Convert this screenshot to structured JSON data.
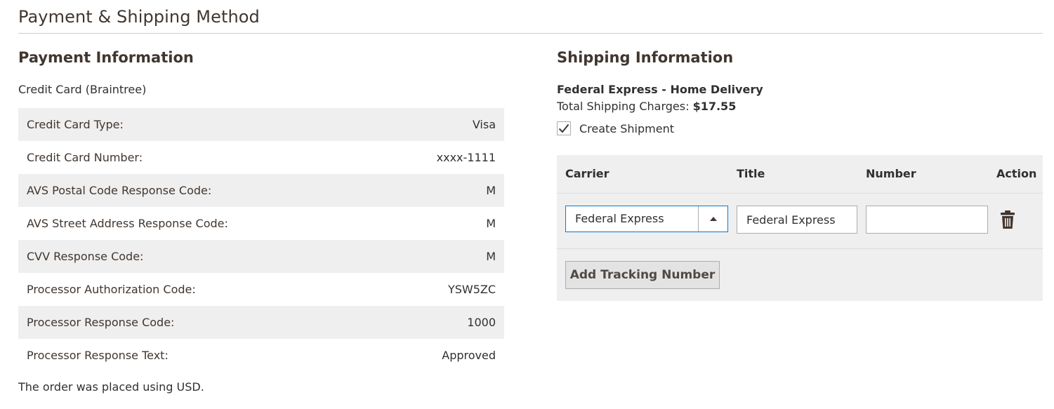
{
  "section": {
    "title": "Payment & Shipping Method"
  },
  "payment": {
    "heading": "Payment Information",
    "method": "Credit Card (Braintree)",
    "rows": [
      {
        "label": "Credit Card Type:",
        "value": "Visa"
      },
      {
        "label": "Credit Card Number:",
        "value": "xxxx-1111"
      },
      {
        "label": "AVS Postal Code Response Code:",
        "value": "M"
      },
      {
        "label": "AVS Street Address Response Code:",
        "value": "M"
      },
      {
        "label": "CVV Response Code:",
        "value": "M"
      },
      {
        "label": "Processor Authorization Code:",
        "value": "YSW5ZC"
      },
      {
        "label": "Processor Response Code:",
        "value": "1000"
      },
      {
        "label": "Processor Response Text:",
        "value": "Approved"
      }
    ],
    "order_note": "The order was placed using USD."
  },
  "shipping": {
    "heading": "Shipping Information",
    "method": "Federal Express - Home Delivery",
    "charges_label": "Total Shipping Charges:",
    "charges_value": "$17.55",
    "create_shipment_label": "Create Shipment",
    "create_shipment_checked": true,
    "tracking": {
      "headers": {
        "carrier": "Carrier",
        "title": "Title",
        "number": "Number",
        "action": "Action"
      },
      "row": {
        "carrier": "Federal Express",
        "title": "Federal Express",
        "number": ""
      },
      "add_button": "Add Tracking Number",
      "action_icon": "trash-icon"
    }
  },
  "colors": {
    "select_focus_border": "#007bdb",
    "stripe": "#efefef",
    "text": "#303030"
  }
}
